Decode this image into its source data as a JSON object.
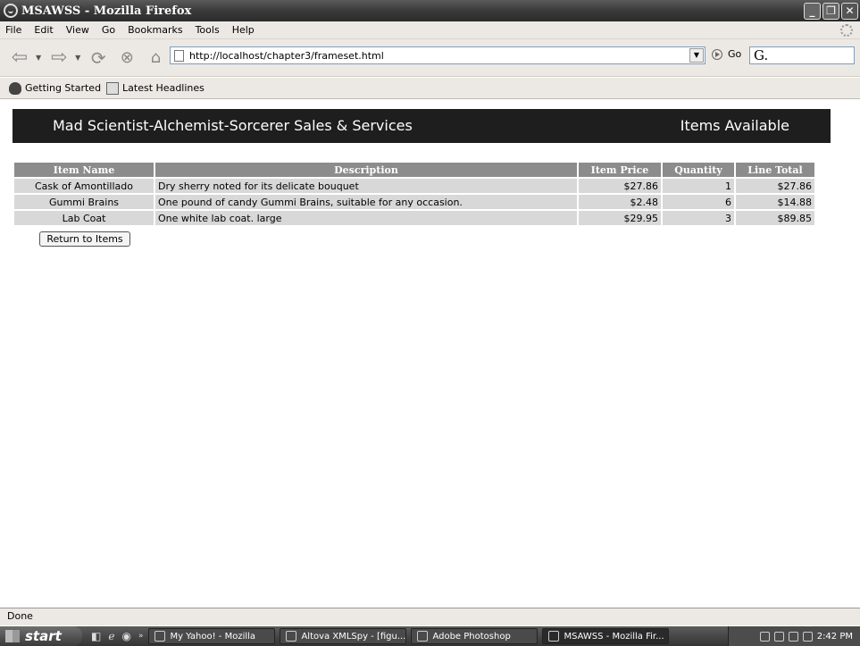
{
  "window": {
    "title": "MSAWSS - Mozilla Firefox"
  },
  "menu": [
    "File",
    "Edit",
    "View",
    "Go",
    "Bookmarks",
    "Tools",
    "Help"
  ],
  "navigation": {
    "url": "http://localhost/chapter3/frameset.html",
    "go_label": "Go",
    "search_value": "G."
  },
  "bookmarks": [
    {
      "label": "Getting Started",
      "icon": "getting-started-icon"
    },
    {
      "label": "Latest Headlines",
      "icon": "rss-icon"
    }
  ],
  "banner": {
    "title": "Mad Scientist-Alchemist-Sorcerer Sales & Services",
    "right_label": "Items Available"
  },
  "table": {
    "headers": [
      "Item Name",
      "Description",
      "Item Price",
      "Quantity",
      "Line Total"
    ],
    "rows": [
      {
        "name": "Cask of Amontillado",
        "description": "Dry sherry noted for its delicate bouquet",
        "price": "$27.86",
        "quantity": "1",
        "total": "$27.86"
      },
      {
        "name": "Gummi Brains",
        "description": "One pound of candy Gummi Brains, suitable for any occasion.",
        "price": "$2.48",
        "quantity": "6",
        "total": "$14.88"
      },
      {
        "name": "Lab Coat",
        "description": "One white lab coat. large",
        "price": "$29.95",
        "quantity": "3",
        "total": "$89.85"
      }
    ]
  },
  "return_button": "Return to Items",
  "status": "Done",
  "taskbar": {
    "start_label": "start",
    "tasks": [
      "My Yahoo! - Mozilla",
      "Altova XMLSpy - [figu...",
      "Adobe Photoshop",
      "MSAWSS - Mozilla Fir..."
    ],
    "clock": "2:42 PM"
  }
}
